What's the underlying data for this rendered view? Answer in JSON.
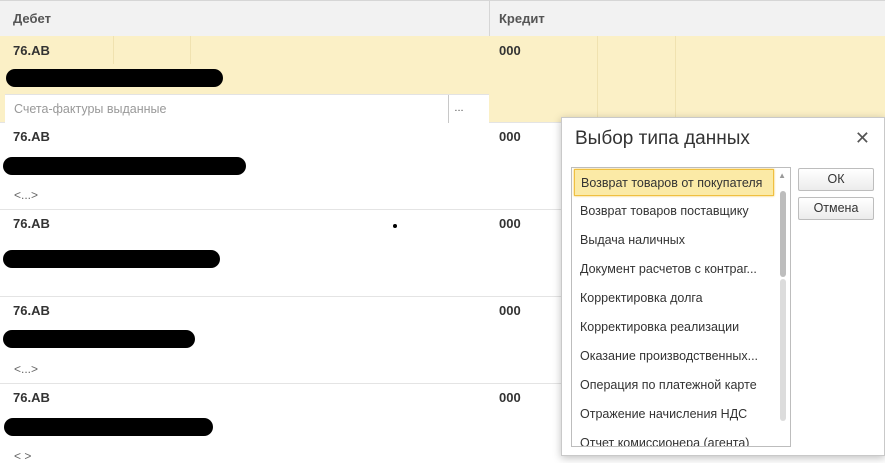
{
  "header": {
    "debit": "Дебет",
    "credit": "Кредит"
  },
  "rows": [
    {
      "account": "76.АВ",
      "credit": "000",
      "input_placeholder": "Счета-фактуры выданные",
      "select_button": "..."
    },
    {
      "account": "76.АВ",
      "credit": "000",
      "more": "<...>"
    },
    {
      "account": "76.АВ",
      "credit": "000"
    },
    {
      "account": "76.АВ",
      "credit": "000",
      "more": "<...>"
    },
    {
      "account": "76.АВ",
      "credit": "000",
      "more": "<  >"
    }
  ],
  "dialog": {
    "title": "Выбор типа данных",
    "ok": "ОК",
    "cancel": "Отмена",
    "items": [
      "Возврат товаров от покупателя",
      "Возврат товаров поставщику",
      "Выдача наличных",
      "Документ расчетов с контраг...",
      "Корректировка долга",
      "Корректировка реализации",
      "Оказание производственных...",
      "Операция по платежной карте",
      "Отражение начисления НДС",
      "Отчет комиссионера (агента)"
    ],
    "selected_index": 0
  },
  "icons": {
    "close": "close-icon",
    "scroll_up": "scroll-up-arrow-icon"
  }
}
